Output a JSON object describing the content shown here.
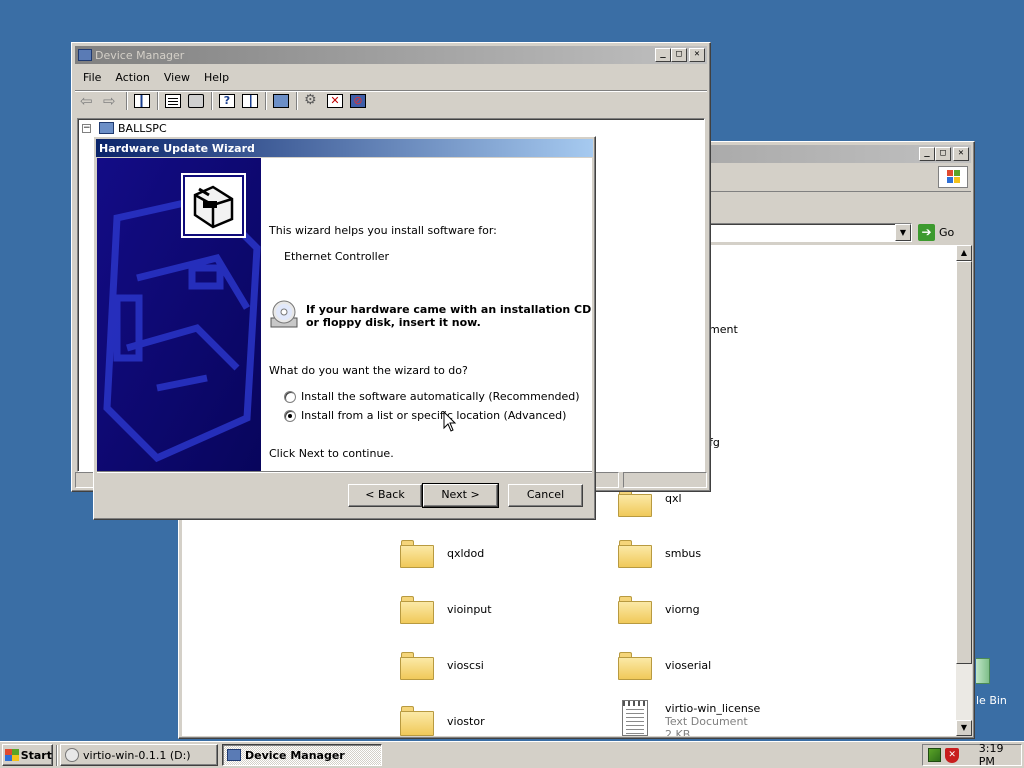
{
  "explorer": {
    "go_label": "Go",
    "partial_labels": [
      "ment",
      "fg"
    ],
    "folders": [
      {
        "name": "qxl"
      },
      {
        "name": "qxldod"
      },
      {
        "name": "smbus"
      },
      {
        "name": "vioinput"
      },
      {
        "name": "viorng"
      },
      {
        "name": "vioscsi"
      },
      {
        "name": "vioserial"
      },
      {
        "name": "viostor"
      }
    ],
    "license": {
      "name": "virtio-win_license",
      "type": "Text Document",
      "size": "2 KB"
    }
  },
  "desktop": {
    "recycle_label": "le Bin"
  },
  "device_manager": {
    "title": "Device Manager",
    "menu": [
      "File",
      "Action",
      "View",
      "Help"
    ],
    "tree_root": "BALLSPC"
  },
  "wizard": {
    "title": "Hardware Update Wizard",
    "intro": "This wizard helps you install software for:",
    "device": "Ethernet Controller",
    "cd_line1": "If your hardware came with an installation CD",
    "cd_line2": "or floppy disk, insert it now.",
    "question": "What do you want the wizard to do?",
    "option_auto": "Install the software automatically (Recommended)",
    "option_list": "Install from a list or specific location (Advanced)",
    "selected": "option_list",
    "continue": "Click Next to continue.",
    "back": "< Back",
    "next": "Next >",
    "cancel": "Cancel"
  },
  "taskbar": {
    "start": "Start",
    "tasks": [
      "virtio-win-0.1.1 (D:)",
      "Device Manager"
    ],
    "active_task": 1,
    "clock": "3:19 PM"
  }
}
